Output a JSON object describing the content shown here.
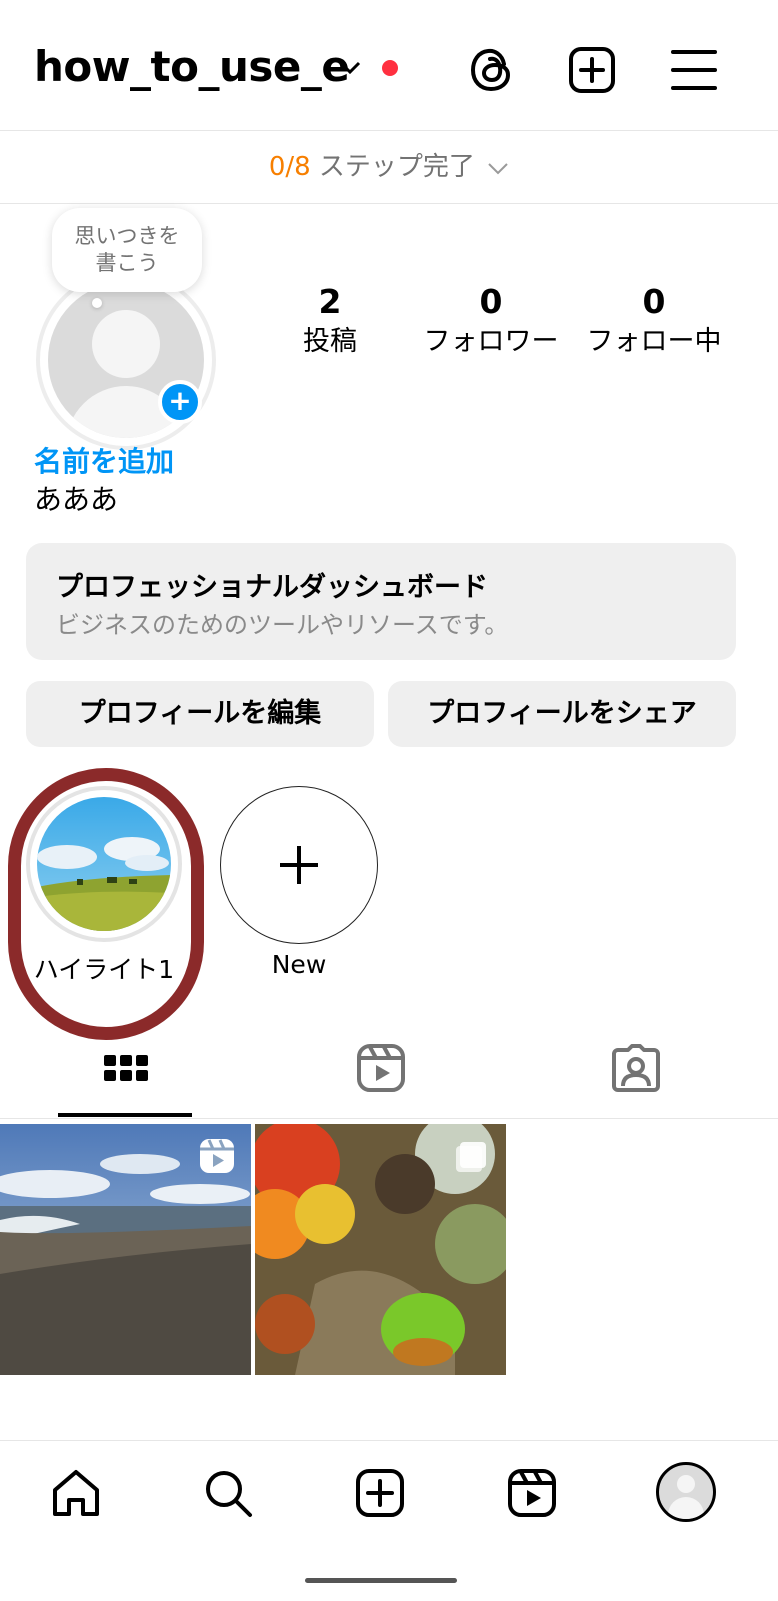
{
  "header": {
    "username": "how_to_use_e",
    "icons": [
      "chevron-down-icon",
      "notification-dot",
      "threads-icon",
      "create-icon",
      "menu-icon"
    ]
  },
  "steps": {
    "count": "0/8",
    "label": " ステップ完了"
  },
  "profile": {
    "note_bubble": "思いつきを\n書こう",
    "stats": [
      {
        "num": "2",
        "label": "投稿"
      },
      {
        "num": "0",
        "label": "フォロワー"
      },
      {
        "num": "0",
        "label": "フォロー中"
      }
    ],
    "add_name": "名前を追加",
    "bio": "あああ"
  },
  "dashboard": {
    "title": "プロフェッショナルダッシュボード",
    "subtitle": "ビジネスのためのツールやリソースです。"
  },
  "buttons": {
    "edit": "プロフィールを編集",
    "share": "プロフィールをシェア"
  },
  "highlights": [
    {
      "label": "ハイライト1"
    },
    {
      "label": "New"
    }
  ],
  "tabs": [
    "grid-icon",
    "reels-icon",
    "tagged-icon"
  ],
  "posts": [
    {
      "type": "reel",
      "subject": "beach"
    },
    {
      "type": "multi",
      "subject": "autumn-leaves"
    }
  ],
  "colors": {
    "accent": "#0095f6",
    "step_count": "#f77f00",
    "dot": "#ff3040",
    "annotation": "#8b2a2a"
  }
}
